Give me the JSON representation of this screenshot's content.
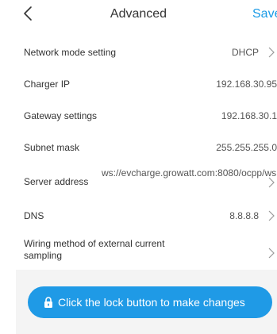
{
  "header": {
    "back_icon": "chevron-left-icon",
    "title": "Advanced",
    "save_label": "Save"
  },
  "settings": {
    "network_mode": {
      "label": "Network mode setting",
      "value": "DHCP"
    },
    "charger_ip": {
      "label": "Charger IP",
      "value": "192.168.30.95"
    },
    "gateway": {
      "label": "Gateway settings",
      "value": "192.168.30.1"
    },
    "subnet_mask": {
      "label": "Subnet mask",
      "value": "255.255.255.0"
    },
    "server_address": {
      "label": "Server address",
      "value": "ws://evcharge.growatt.com:8080/ocpp/ws"
    },
    "dns": {
      "label": "DNS",
      "value": "8.8.8.8"
    },
    "wiring_method": {
      "label": "Wiring method of external current sampling",
      "value": ""
    }
  },
  "lock_button": {
    "icon": "lock-icon",
    "label": "Click the lock button to make changes"
  },
  "colors": {
    "accent": "#1f9ae6",
    "save_text": "#1a9be6",
    "text": "#333333",
    "value_text": "#555555",
    "chevron": "#999999",
    "panel_bg": "#f4f4f4"
  }
}
